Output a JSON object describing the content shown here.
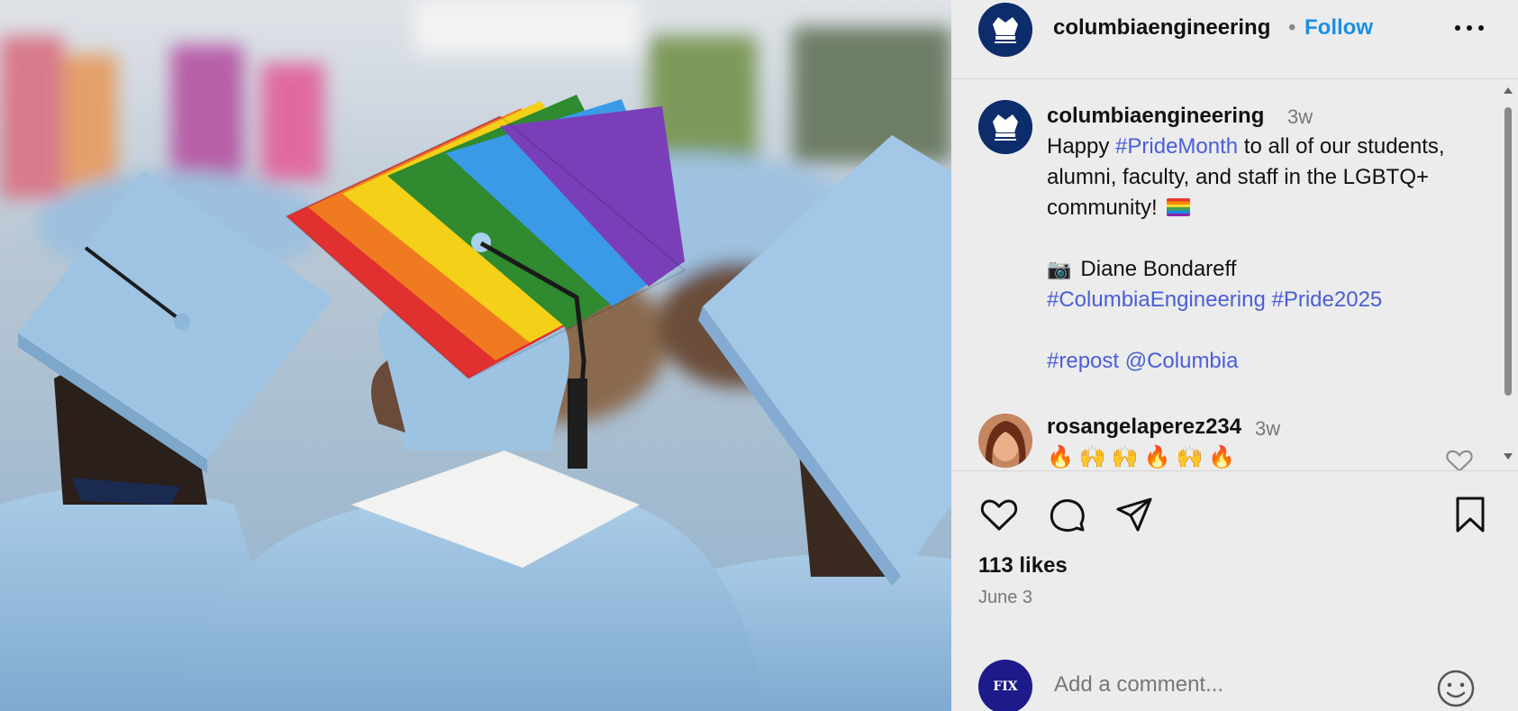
{
  "post": {
    "image_alt": "Graduates in light blue caps and gowns, one wearing a rainbow-striped mortarboard"
  },
  "header": {
    "username": "columbiaengineering",
    "separator": "•",
    "follow_label": "Follow",
    "more_icon": "more-horizontal-icon"
  },
  "caption": {
    "username": "columbiaengineering",
    "time": "3w",
    "line1_pre": "Happy ",
    "line1_tag": "#PrideMonth",
    "line1_post": " to all of our students, alumni, faculty, and staff in the LGBTQ+ community! ",
    "camera_emoji": "📷",
    "photo_credit": "Diane Bondareff",
    "tags_line": "#ColumbiaEngineering #Pride2025",
    "repost": "#repost @Columbia"
  },
  "comments": [
    {
      "username": "rosangelaperez234",
      "time": "3w",
      "text": "🔥🙌🙌🔥🙌🔥"
    }
  ],
  "actions": {
    "like_icon": "heart-icon",
    "comment_icon": "comment-icon",
    "share_icon": "send-icon",
    "save_icon": "bookmark-icon"
  },
  "likes_text": "113 likes",
  "date": "June 3",
  "add_comment": {
    "avatar_text": "FIX",
    "placeholder": "Add a comment...",
    "emoji_icon": "smiley-icon"
  },
  "colors": {
    "link_blue": "#1a8fe6",
    "hashtag": "#4a5ed9",
    "columbia_navy": "#0c2c6b"
  }
}
